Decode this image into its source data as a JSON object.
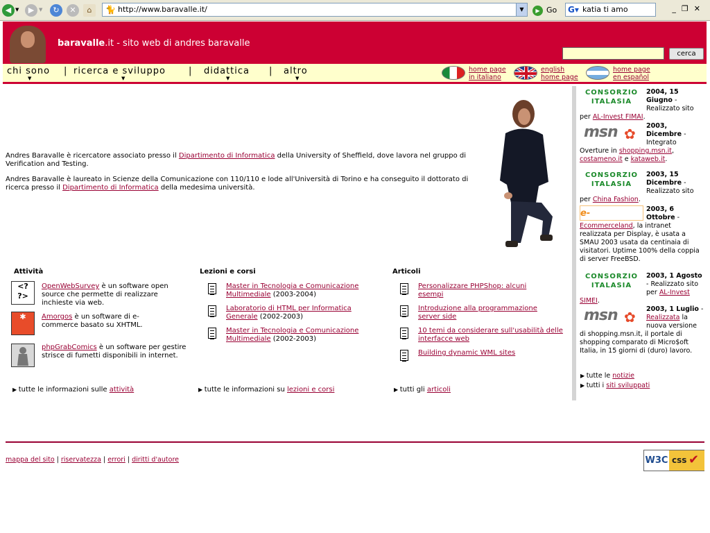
{
  "browser": {
    "url": "http://www.baravalle.it/",
    "go_label": "Go",
    "search_value": "katia ti amo"
  },
  "header": {
    "site_name": "baravalle",
    "site_tld": ".it",
    "tagline": " - sito web di andres baravalle",
    "search_button": "cerca"
  },
  "nav": {
    "items": [
      "chi sono",
      "ricerca e sviluppo",
      "didattica",
      "altro"
    ],
    "separator": "|",
    "lang": [
      {
        "line1": "home page",
        "line2": "in italiano"
      },
      {
        "line1": "english",
        "line2": "home page"
      },
      {
        "line1": "home page",
        "line2": "en español"
      }
    ]
  },
  "intro": {
    "p1_a": "Andres Baravalle è ricercatore associato presso il ",
    "p1_link": "Dipartimento di Informatica",
    "p1_b": " della University of Sheffield, dove lavora nel gruppo di Verification and Testing.",
    "p2_a": "Andres Baravalle è laureato in Scienze della Comunicazione con 110/110 e lode all'Università di Torino e ha conseguito il dottorato di ricerca presso il ",
    "p2_link": "Dipartimento di Informatica",
    "p2_b": " della medesima università."
  },
  "attivita": {
    "title": "Attività",
    "items": [
      {
        "link": "OpenWebSurvey",
        "text": " è un software open source che permette di realizzare inchieste via web."
      },
      {
        "link": "Amorgos",
        "text": " è un software di e-commerce basato su XHTML."
      },
      {
        "link": "phpGrabComics",
        "text": " è un software per gestire strisce di fumetti disponibili in internet."
      }
    ],
    "footer_text": "tutte le informazioni sulle ",
    "footer_link": "attività"
  },
  "lezioni": {
    "title": "Lezioni e corsi",
    "items": [
      {
        "link": "Master in Tecnologia e Comunicazione Multimediale",
        "text": " (2003-2004)"
      },
      {
        "link": "Laboratorio di HTML per Informatica Generale",
        "text": " (2002-2003)"
      },
      {
        "link": "Master in Tecnologia e Comunicazione Multimediale",
        "text": " (2002-2003)"
      }
    ],
    "footer_text": "tutte le informazioni su ",
    "footer_link": "lezioni e corsi"
  },
  "articoli": {
    "title": "Articoli",
    "items": [
      {
        "link": "Personalizzare PHPShop: alcuni esempi"
      },
      {
        "link": "Introduzione alla programmazione server side"
      },
      {
        "link": "10 temi da considerare sull'usabilità delle interfacce web"
      },
      {
        "link": "Building dynamic WML sites"
      }
    ],
    "footer_text": "tutti gli ",
    "footer_link": "articoli"
  },
  "news": [
    {
      "logo": "CONSORZIO ITALASIA",
      "date": "2004, 15 Giugno",
      "a": " - Realizzato sito per ",
      "l1": "AL-Invest FIMAI",
      "b": "."
    },
    {
      "logo": "msn",
      "date": "2003, Dicembre",
      "a": " - Integrato Overture in ",
      "l1": "shopping.msn.it",
      "b": ", ",
      "l2": "costameno.it",
      "c": " e ",
      "l3": "kataweb.it",
      "d": "."
    },
    {
      "logo": "CONSORZIO ITALASIA",
      "date": "2003, 15 Dicembre",
      "a": " - Realizzato sito per ",
      "l1": "China Fashion",
      "b": "."
    },
    {
      "logo": "e-commerceland",
      "date": "2003, 6 Ottobre",
      "a": " - ",
      "l1": "Ecommerceland",
      "b": ", la intranet realizzata per Display, è usata a SMAU 2003 usata da centinaia di visitatori. Uptime 100% della coppia di server FreeBSD."
    },
    {
      "logo": "CONSORZIO ITALASIA",
      "date": "2003, 1 Agosto",
      "a": " - Realizzato sito per ",
      "l1": "AL-Invest SIMEI",
      "b": "."
    },
    {
      "logo": "msn",
      "date": "2003, 1 Luglio",
      "a": " - ",
      "l1": "Realizzata",
      "b": " la nuova versione di shopping.msn.it, il portale di shopping comparato di Micro$oft Italia, in 15 giorni di (duro) lavoro."
    }
  ],
  "news_more": [
    {
      "text": "tutte le ",
      "link": "notizie"
    },
    {
      "text": "tutti i ",
      "link": "siti sviluppati"
    }
  ],
  "footer": {
    "links": [
      "mappa del sito",
      "riservatezza",
      "errori",
      "diritti d'autore"
    ],
    "sep": " | ",
    "badge_w3c": "W3C",
    "badge_css": "css"
  }
}
